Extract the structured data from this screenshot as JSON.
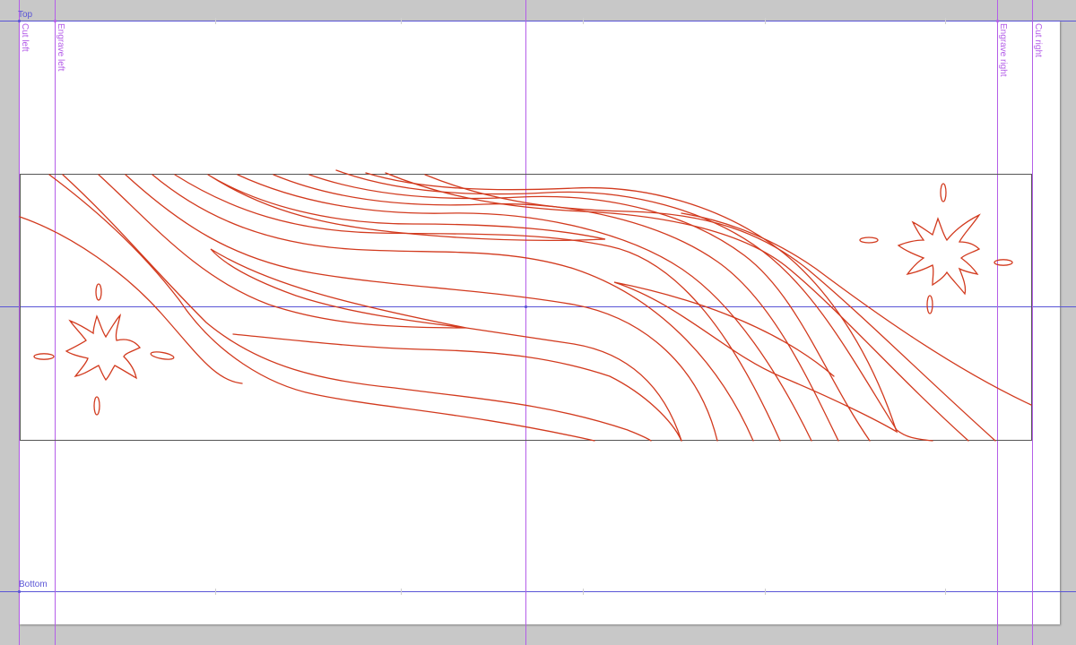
{
  "colors": {
    "pasteboard": "#c8c8c8",
    "artboard": "#ffffff",
    "horizontal_guide": "#5a55d6",
    "vertical_guide": "#b45ee8",
    "engrave_stroke": "#d23a1e",
    "frame_stroke": "#555555"
  },
  "guides": {
    "top": "Top",
    "bottom": "Bottom",
    "cut_left": "Cut left",
    "engrave_left": "Engrave left",
    "engrave_right": "Engrave right",
    "cut_right": "Cut right"
  },
  "artwork": {
    "motifs": [
      "wood-grain-lines",
      "splash-left",
      "splash-right"
    ]
  }
}
